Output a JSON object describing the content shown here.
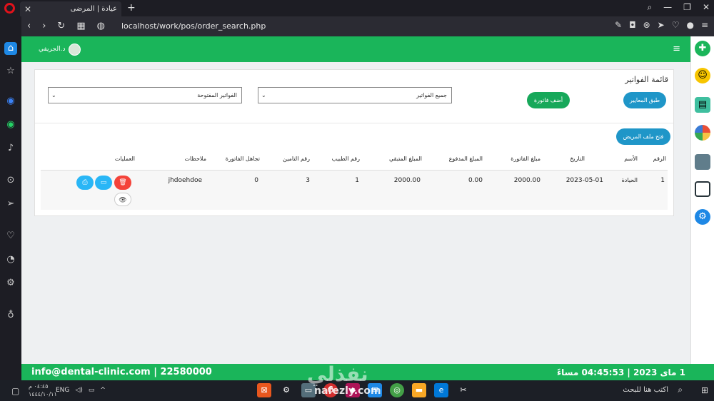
{
  "browser": {
    "tab_title": "عيادة | المرضى",
    "url": "localhost/work/pos/order_search.php"
  },
  "header": {
    "user_name": "د.الجريفي"
  },
  "page": {
    "title": "قائمة الفواتير",
    "apply_filters_label": "طبق المعايير",
    "add_invoice_label": "أضف فاتورة",
    "select_all_value": "جميع الفواتير",
    "select_open_value": "الفواتير المفتوحة",
    "open_file_label": "فتح ملف المريض"
  },
  "table": {
    "headers": [
      "الرقم",
      "الأسم",
      "التاريخ",
      "مبلغ الفاتورة",
      "المبلغ المدفوع",
      "المبلغ المتبقي",
      "رقم الطبيب",
      "رقم التامين",
      "تجاهل الفاتورة",
      "ملاحظات",
      "العمليات"
    ],
    "rows": [
      {
        "id": "1",
        "name": "الحيادة",
        "date": "2023-05-01",
        "amount": "2000.00",
        "paid": "0.00",
        "remaining": "2000.00",
        "doctor_no": "1",
        "insurance_no": "3",
        "ignore": "0",
        "notes": "jhdoehdoe"
      }
    ]
  },
  "footer": {
    "contact": "info@dental-clinic.com | 22580000",
    "datetime": "1 مای 2023 | 04:45:53 مساءً"
  },
  "taskbar": {
    "search_placeholder": "اكتب هنا للبحث",
    "lang": "ENG",
    "time": "٠٤:٤٥ م",
    "date": "١٤٤٤/١٠/١١"
  },
  "watermark": {
    "text": "نفذلي",
    "url": "nafezly.com"
  }
}
